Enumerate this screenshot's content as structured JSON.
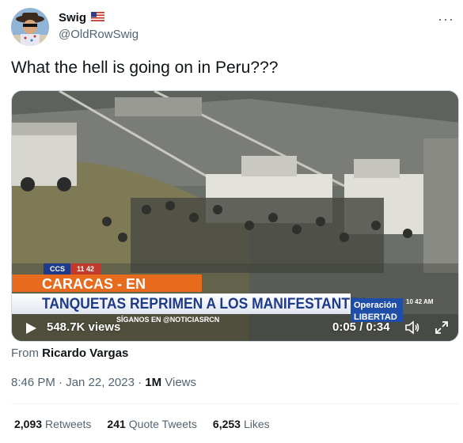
{
  "author": {
    "display_name": "Swig",
    "flag": "🇺🇸",
    "handle": "@OldRowSwig"
  },
  "more_icon": "···",
  "tweet_text": "What the hell is going on in Peru???",
  "video": {
    "ticker_tag": "CCS",
    "ticker_time": "11 42",
    "headline_top": "CARACAS - EN DIRECTO",
    "headline_bottom": "TANQUETAS REPRIMEN A LOS MANIFESTANTES",
    "operation_label_1": "Operación",
    "operation_label_2": "LIBERTAD",
    "small_clock": "10 42 AM",
    "follow_text": "SÍGANOS EN @NOTICIASRCN",
    "views": "548.7K views",
    "timecode": "0:05 / 0:34"
  },
  "from": {
    "prefix": "From",
    "source": "Ricardo Vargas"
  },
  "meta": {
    "timestamp": "8:46 PM · Jan 22, 2023 · ",
    "views_count": "1M",
    "views_label": " Views"
  },
  "stats": {
    "retweets_count": "2,093",
    "retweets_label": "Retweets",
    "quotes_count": "241",
    "quotes_label": "Quote Tweets",
    "likes_count": "6,253",
    "likes_label": "Likes"
  }
}
